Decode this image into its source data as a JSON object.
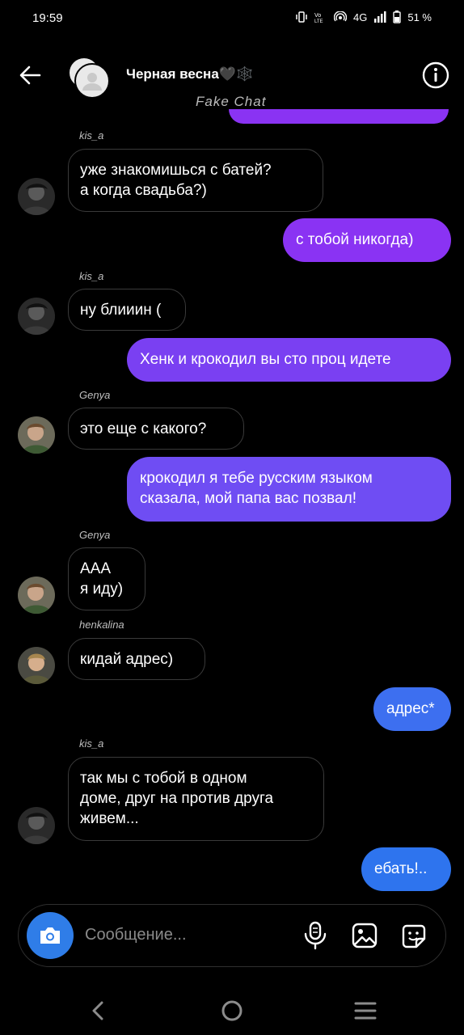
{
  "status_bar": {
    "time": "19:59",
    "network": "4G",
    "battery": "51 %"
  },
  "header": {
    "title": "Черная весна🖤🕸️",
    "watermark": "Fake Chat"
  },
  "messages": [
    {
      "sender": "kis_a",
      "text1": "уже знакомишься с батей?",
      "text2": "а когда свадьба?)"
    },
    {
      "text": "с тобой никогда)"
    },
    {
      "sender": "kis_a",
      "text": "ну блииин ("
    },
    {
      "text": "Хенк и крокодил вы сто проц идете"
    },
    {
      "sender": "Genya",
      "text": "это еще с какого?"
    },
    {
      "text1": "крокодил я тебе русским языком",
      "text2": "сказала, мой папа вас позвал!"
    },
    {
      "sender": "Genya",
      "text1": "ААА",
      "text2": "я иду)"
    },
    {
      "sender": "henkalina",
      "text": "кидай адрес)"
    },
    {
      "text": "адрес*"
    },
    {
      "sender": "kis_a",
      "text1": "так мы с тобой в одном",
      "text2": "доме, друг на против друга",
      "text3": "живем..."
    },
    {
      "text": "ебать!.."
    }
  ],
  "composer": {
    "placeholder": "Сообщение..."
  },
  "colors": {
    "purple": "#8a33f3",
    "violet": "#6f4df3",
    "blue": "#3d6ff0",
    "camera": "#2f7de8"
  }
}
